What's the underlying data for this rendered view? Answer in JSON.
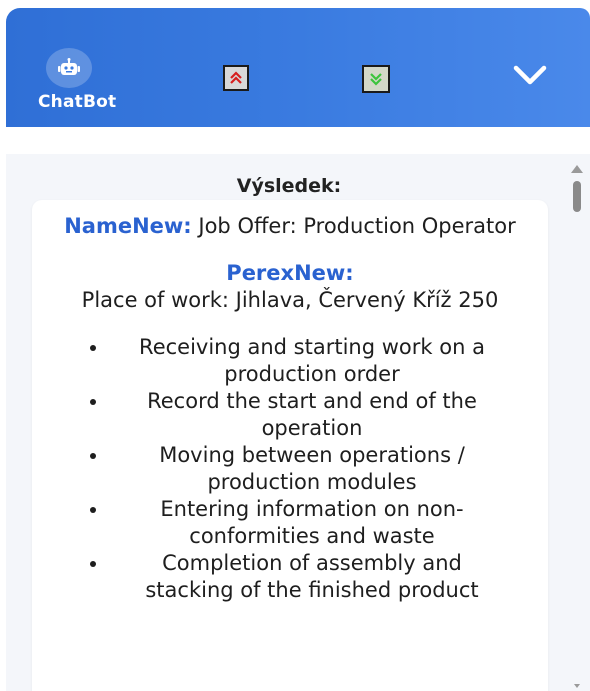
{
  "header": {
    "brand_label": "ChatBot",
    "bot_icon": "robot-icon",
    "scroll_up_icon": "double-chevron-up-icon",
    "scroll_down_icon": "double-chevron-down-icon",
    "collapse_icon": "chevron-down-icon",
    "accent_color": "#3a7be0"
  },
  "result": {
    "title": "Výsledek:",
    "name_key": "NameNew:",
    "name_value": "Job Offer: Production Operator",
    "perex_key": "PerexNew:",
    "perex_value": "Place of work: Jihlava, Červený Kříž 250",
    "bullets": [
      "Receiving and starting work on a production order",
      "Record the start and end of the operation",
      "Moving between operations / production modules",
      "Entering information on non-conformities and waste",
      "Completion of assembly and stacking of the finished product"
    ],
    "key_color": "#2a62d0"
  }
}
